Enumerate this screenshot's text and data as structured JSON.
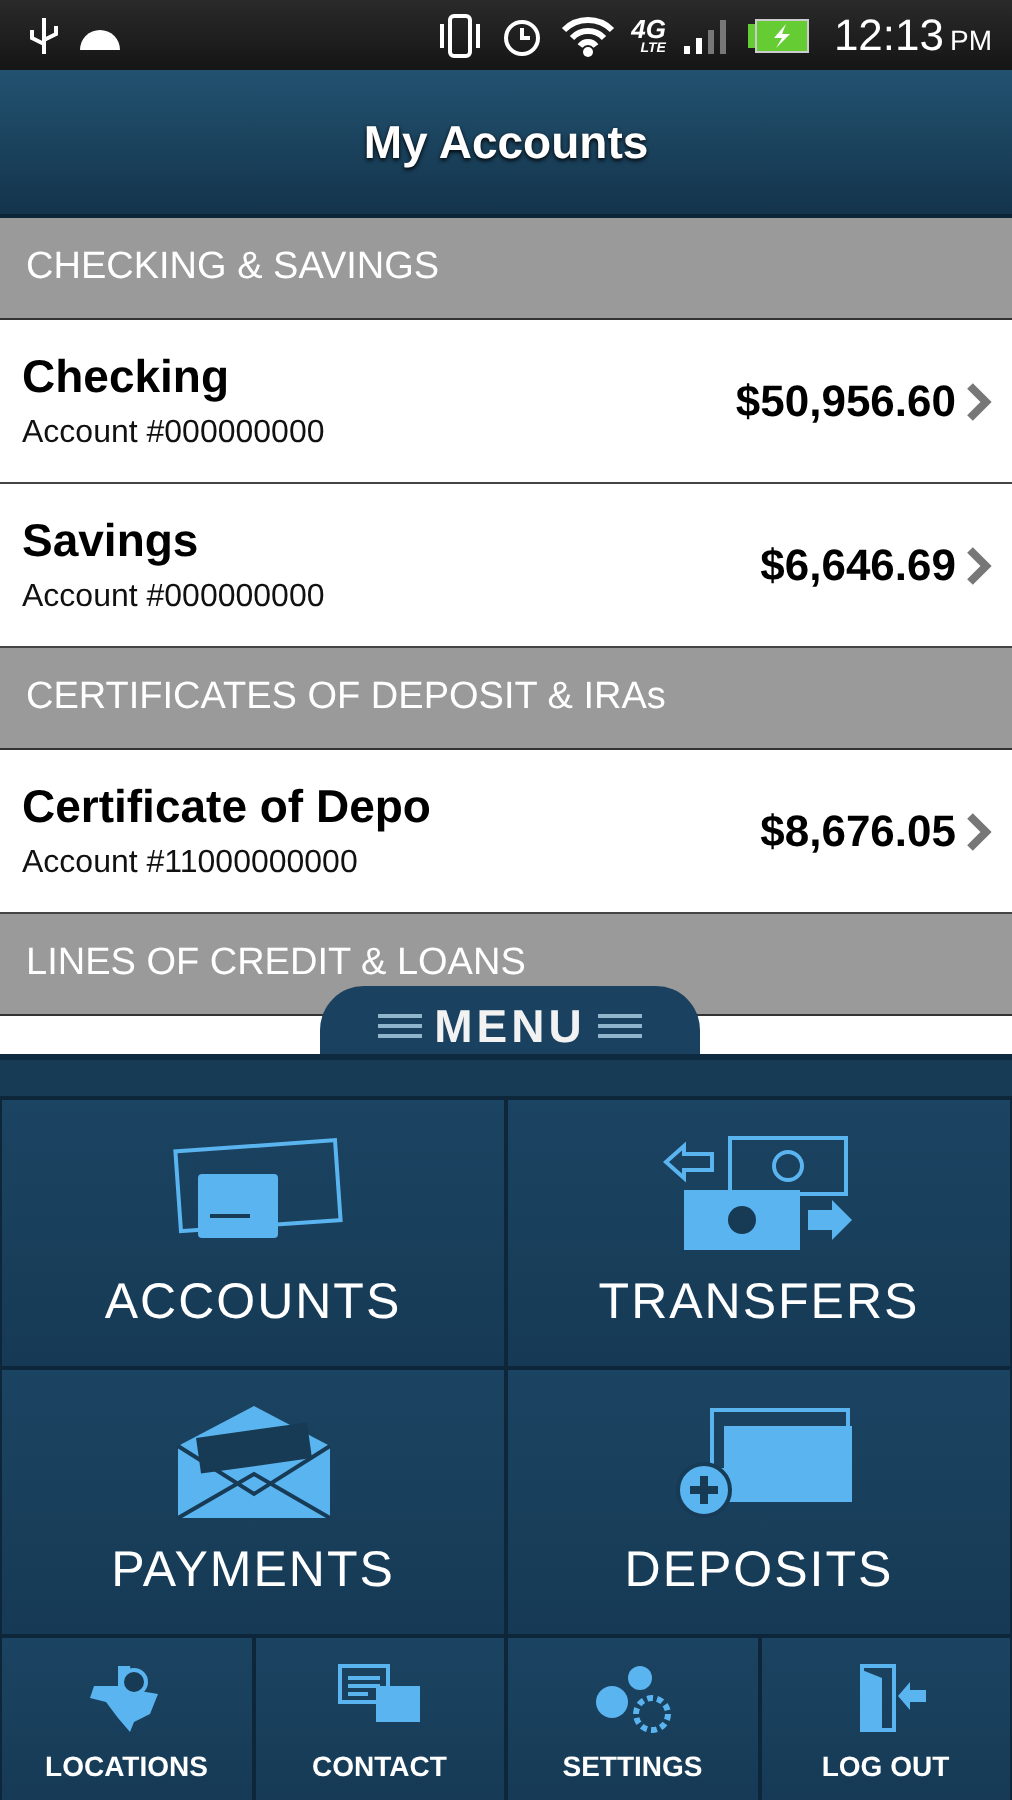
{
  "status_bar": {
    "network": "4G",
    "network_sub": "LTE",
    "time": "12:13",
    "ampm": "PM"
  },
  "header": {
    "title": "My Accounts"
  },
  "sections": [
    {
      "title": "CHECKING & SAVINGS",
      "accounts": [
        {
          "name": "Checking",
          "number": "Account #000000000",
          "balance": "$50,956.60"
        },
        {
          "name": "Savings",
          "number": "Account #000000000",
          "balance": "$6,646.69"
        }
      ]
    },
    {
      "title": "CERTIFICATES OF DEPOSIT & IRAs",
      "accounts": [
        {
          "name": "Certificate of Depo",
          "number": "Account #11000000000",
          "balance": "$8,676.05"
        }
      ]
    },
    {
      "title": "LINES OF CREDIT & LOANS"
    }
  ],
  "menu": {
    "title": "MENU",
    "main_items": [
      {
        "label": "ACCOUNTS",
        "kind": "accounts"
      },
      {
        "label": "TRANSFERS",
        "kind": "transfers"
      },
      {
        "label": "PAYMENTS",
        "kind": "payments"
      },
      {
        "label": "DEPOSITS",
        "kind": "deposits"
      }
    ],
    "bottom_items": [
      {
        "label": "LOCATIONS",
        "kind": "locations"
      },
      {
        "label": "CONTACT",
        "kind": "contact"
      },
      {
        "label": "SETTINGS",
        "kind": "settings"
      },
      {
        "label": "LOG OUT",
        "kind": "logout"
      }
    ]
  }
}
